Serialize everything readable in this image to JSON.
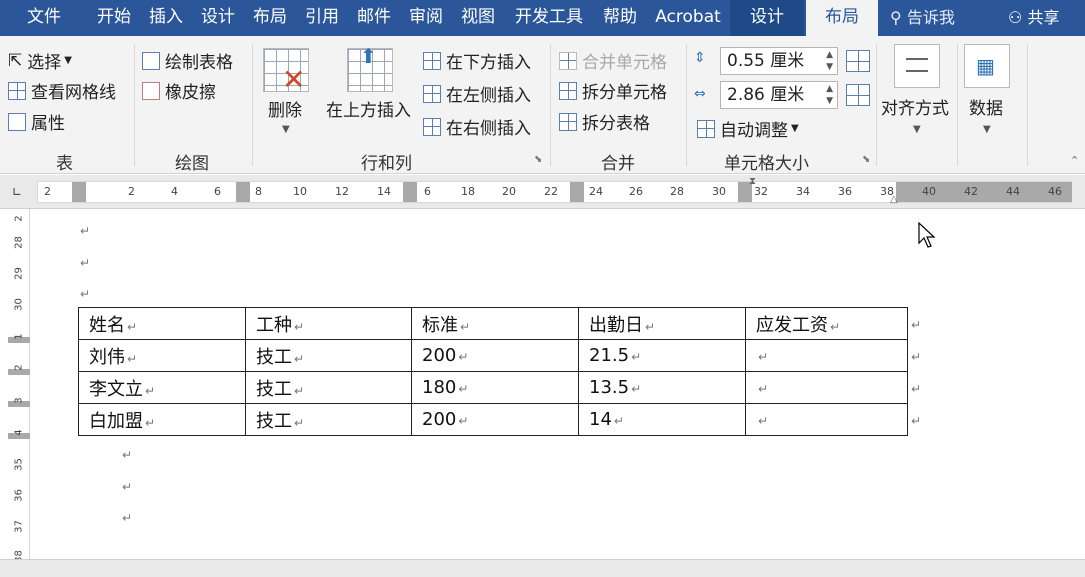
{
  "tabs": [
    {
      "key": "file",
      "label": "文件"
    },
    {
      "key": "home",
      "label": "开始"
    },
    {
      "key": "insert",
      "label": "插入"
    },
    {
      "key": "design",
      "label": "设计"
    },
    {
      "key": "layout",
      "label": "布局"
    },
    {
      "key": "references",
      "label": "引用"
    },
    {
      "key": "mailings",
      "label": "邮件"
    },
    {
      "key": "review",
      "label": "审阅"
    },
    {
      "key": "view",
      "label": "视图"
    },
    {
      "key": "developer",
      "label": "开发工具"
    },
    {
      "key": "help",
      "label": "帮助"
    },
    {
      "key": "acrobat",
      "label": "Acrobat"
    },
    {
      "key": "table-design",
      "label": "设计"
    },
    {
      "key": "table-layout",
      "label": "布局"
    }
  ],
  "tell_me": {
    "label": "告诉我"
  },
  "share": {
    "label": "共享"
  },
  "ribbon": {
    "table_group": {
      "select": "选择",
      "view_gridlines": "查看网格线",
      "properties": "属性",
      "label": "表"
    },
    "draw_group": {
      "draw_table": "绘制表格",
      "eraser": "橡皮擦",
      "label": "绘图"
    },
    "rows_cols_group": {
      "delete": "删除",
      "insert_above": "在上方插入",
      "insert_below": "在下方插入",
      "insert_left": "在左侧插入",
      "insert_right": "在右侧插入",
      "label": "行和列"
    },
    "merge_group": {
      "merge_cells": "合并单元格",
      "split_cells": "拆分单元格",
      "split_table": "拆分表格",
      "label": "合并"
    },
    "cell_size_group": {
      "height": "0.55 厘米",
      "width": "2.86 厘米",
      "autofit": "自动调整",
      "label": "单元格大小"
    },
    "alignment": {
      "label": "对齐方式"
    },
    "data": {
      "label": "数据"
    }
  },
  "ruler": {
    "h_labels": [
      "2",
      "2",
      "4",
      "6",
      "8",
      "10",
      "12",
      "14",
      "6",
      "18",
      "20",
      "22",
      "24",
      "26",
      "28",
      "30",
      "32",
      "34",
      "36",
      "38",
      "40",
      "42",
      "44",
      "46"
    ],
    "v_labels": [
      "2",
      "28",
      "29",
      "30",
      "1",
      "2",
      "3",
      "4",
      "35",
      "36",
      "37",
      "38"
    ]
  },
  "table": {
    "headers": [
      "姓名",
      "工种",
      "标准",
      "出勤日",
      "应发工资"
    ],
    "rows": [
      [
        "刘伟",
        "技工",
        "200",
        "21.5",
        ""
      ],
      [
        "李文立",
        "技工",
        "180",
        "13.5",
        ""
      ],
      [
        "白加盟",
        "技工",
        "200",
        "14",
        ""
      ]
    ]
  },
  "paragraph_mark": "↵"
}
